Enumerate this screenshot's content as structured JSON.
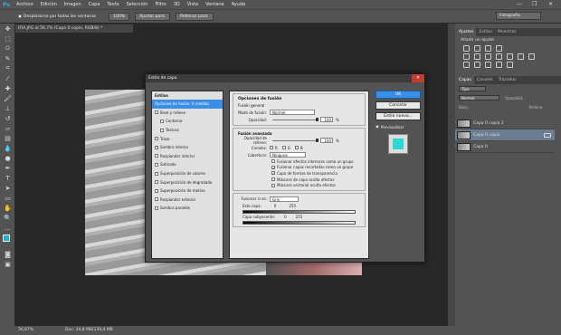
{
  "menubar": {
    "items": [
      "Archivo",
      "Edición",
      "Imagen",
      "Capa",
      "Texto",
      "Selección",
      "Filtro",
      "3D",
      "Vista",
      "Ventana",
      "Ayuda"
    ],
    "controls": [
      "—",
      "❐",
      "✕"
    ]
  },
  "options": {
    "scroll_all": "Desplazarse por todas las ventanas",
    "btn1": "100%",
    "btn2": "Ajustar pant.",
    "btn3": "Rellenar pant.",
    "workspace": "Fotografía"
  },
  "document": {
    "tab": "IFIA.JPG al 56,7% (Capa 0 copia, RGB/8) *",
    "zoom": "56,67%",
    "doc_size": "Doc: 34,8 MB/139,4 MB"
  },
  "panels": {
    "adjust_tabs": [
      "Ajustes",
      "Estilos",
      "Muestras"
    ],
    "adjust_title": "Añadir un ajuste",
    "layer_tabs": [
      "Capas",
      "Canales",
      "Trazados"
    ],
    "filter_kind": "Tipo",
    "blend_mode": "Normal",
    "opacity_label": "Opacidad:",
    "fill_label": "Relleno:",
    "lock_label": "Bloq.:",
    "layers": [
      {
        "name": "Capa 0 copia 2"
      },
      {
        "name": "Capa 0 copia"
      },
      {
        "name": "Capa 0"
      }
    ]
  },
  "dialog": {
    "title": "Estilo de capa",
    "close": "✕",
    "styles_header": "Estilos",
    "styles": [
      {
        "label": "Opciones de fusión: A medida",
        "active": true,
        "indent": false,
        "checkbox": false
      },
      {
        "label": "Bisel y relieve",
        "active": false,
        "indent": false,
        "checkbox": true
      },
      {
        "label": "Contorno",
        "active": false,
        "indent": true,
        "checkbox": true
      },
      {
        "label": "Textura",
        "active": false,
        "indent": true,
        "checkbox": true
      },
      {
        "label": "Trazo",
        "active": false,
        "indent": false,
        "checkbox": true
      },
      {
        "label": "Sombra interior",
        "active": false,
        "indent": false,
        "checkbox": true
      },
      {
        "label": "Resplandor interior",
        "active": false,
        "indent": false,
        "checkbox": true
      },
      {
        "label": "Satinado",
        "active": false,
        "indent": false,
        "checkbox": true
      },
      {
        "label": "Superposición de colores",
        "active": false,
        "indent": false,
        "checkbox": true
      },
      {
        "label": "Superposición de degradado",
        "active": false,
        "indent": false,
        "checkbox": true
      },
      {
        "label": "Superposición de motivo",
        "active": false,
        "indent": false,
        "checkbox": true
      },
      {
        "label": "Resplandor exterior",
        "active": false,
        "indent": false,
        "checkbox": true
      },
      {
        "label": "Sombra paralela",
        "active": false,
        "indent": false,
        "checkbox": true
      }
    ],
    "blend_options_title": "Opciones de fusión",
    "general_title": "Fusión general",
    "blend_mode_label": "Modo de fusión:",
    "blend_mode_value": "Normal",
    "opacity_label": "Opacidad:",
    "opacity_value": "100",
    "percent": "%",
    "advanced_title": "Fusión avanzada",
    "fill_opacity_label": "Opacidad de relleno:",
    "fill_opacity_value": "100",
    "channels_label": "Canales:",
    "channels": [
      "R",
      "G",
      "B"
    ],
    "knockout_label": "Cobertura:",
    "knockout_value": "Ninguna",
    "adv_checks": [
      {
        "label": "Fusionar efectos interiores como un grupo",
        "checked": false
      },
      {
        "label": "Fusionar capas recortadas como un grupo",
        "checked": true
      },
      {
        "label": "Capa de formas de transparencia",
        "checked": true
      },
      {
        "label": "Máscara de capa oculta efectos",
        "checked": false
      },
      {
        "label": "Máscara vectorial oculta efectos",
        "checked": false
      }
    ],
    "blend_if_label": "Fusionar si es:",
    "blend_if_value": "Gris",
    "this_layer_label": "Esta capa:",
    "underlying_label": "Capa subyacente:",
    "range_low": "0",
    "range_high": "255",
    "ok": "OK",
    "cancel": "Cancelar",
    "new_style": "Estilo nuevo...",
    "preview_label": "Previsualizar",
    "preview_color": "#2fd6d6"
  }
}
